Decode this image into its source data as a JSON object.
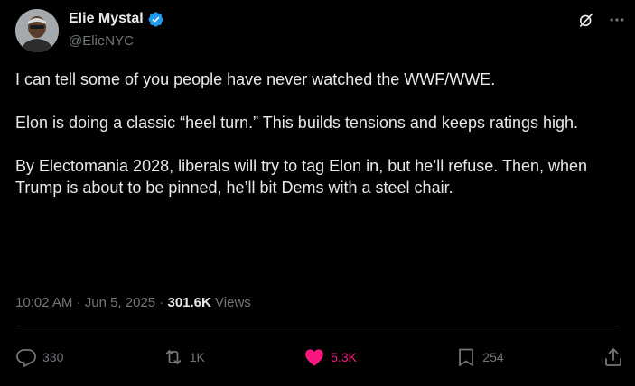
{
  "author": {
    "display_name": "Elie Mystal",
    "handle": "@ElieNYC",
    "verified": true
  },
  "tweet": {
    "paragraphs": [
      "I can tell some of you people have never watched the WWF/WWE.",
      "Elon is doing a classic “heel turn.” This builds tensions and keeps ratings high.",
      "By Electomania 2028, liberals will try to tag Elon in, but he’ll refuse. Then, when Trump is about to be pinned, he’ll bit Dems with a steel chair."
    ],
    "time": "10:02 AM",
    "separator": "·",
    "date": "Jun 5, 2025",
    "views_count": "301.6K",
    "views_label": "Views"
  },
  "actions": {
    "replies": "330",
    "reposts": "1K",
    "likes": "5.3K",
    "bookmarks": "254"
  },
  "icons": {
    "grok": "grok-icon",
    "more": "more-dots-icon",
    "reply": "reply-icon",
    "repost": "repost-icon",
    "like": "heart-icon",
    "bookmark": "bookmark-icon",
    "share": "share-icon"
  },
  "colors": {
    "background": "#000000",
    "text": "#e7e9ea",
    "muted": "#71767b",
    "verified": "#1d9bf0",
    "like": "#f91880",
    "divider": "#2f3336"
  }
}
